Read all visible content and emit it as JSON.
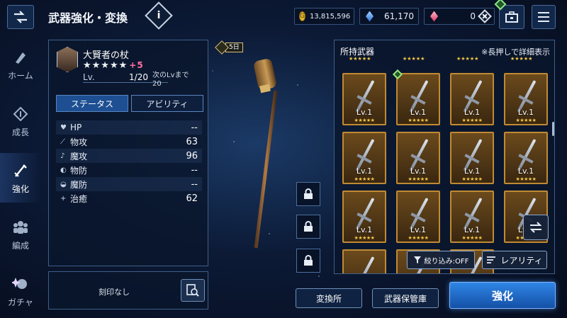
{
  "header": {
    "title": "武器強化・変換",
    "info_label": "i"
  },
  "currency": {
    "gold": "13,815,596",
    "gold_symbol": "G",
    "crystal": "61,170",
    "gem": "0"
  },
  "nav": {
    "items": [
      {
        "label": "ホーム",
        "icon": "home-icon"
      },
      {
        "label": "成長",
        "icon": "growth-icon"
      },
      {
        "label": "強化",
        "icon": "enhance-icon",
        "active": true
      },
      {
        "label": "編成",
        "icon": "party-icon"
      },
      {
        "label": "ガチャ",
        "icon": "gacha-icon"
      }
    ]
  },
  "weapon": {
    "name": "大賢者の杖",
    "stars": "★★★★★",
    "plus": "+5",
    "lv_label": "Lv.",
    "lv_value": "1/20",
    "next_lv_label": "次のLvまで",
    "next_lv_value": "20",
    "limit_badge": "5日"
  },
  "tabs": {
    "status": "ステータス",
    "ability": "アビリティ"
  },
  "stats": [
    {
      "icon": "♥",
      "label": "HP",
      "value": "--"
    },
    {
      "icon": "⟋",
      "label": "物攻",
      "value": "63"
    },
    {
      "icon": "♪",
      "label": "魔攻",
      "value": "96"
    },
    {
      "icon": "◐",
      "label": "物防",
      "value": "--"
    },
    {
      "icon": "◒",
      "label": "魔防",
      "value": "--"
    },
    {
      "icon": "+",
      "label": "治癒",
      "value": "62"
    }
  ],
  "engrave": {
    "label": "刻印なし"
  },
  "owned": {
    "title": "所持武器",
    "hint": "※長押しで詳細表示",
    "slots": [
      {
        "lv": "Lv.1",
        "stars": "★★★★★"
      },
      {
        "lv": "Lv.1",
        "stars": "★★★★★"
      },
      {
        "lv": "Lv.1",
        "stars": "★★★★★"
      },
      {
        "lv": "Lv.1",
        "stars": "★★★★★"
      },
      {
        "lv": "Lv.1",
        "stars": "★★★★★"
      },
      {
        "lv": "Lv.1",
        "stars": "★★★★★"
      },
      {
        "lv": "Lv.1",
        "stars": "★★★★★"
      },
      {
        "lv": "Lv.1",
        "stars": "★★★★★"
      },
      {
        "lv": "Lv.1",
        "stars": "★★★★★"
      },
      {
        "lv": "Lv.1",
        "stars": "★★★★★"
      },
      {
        "lv": "Lv.1",
        "stars": "★★★★★"
      },
      {
        "lv": "Lv.1",
        "stars": "★★★★★"
      }
    ],
    "filter_label": "絞り込み:OFF",
    "rarity_label": "レアリティ"
  },
  "buttons": {
    "exchange": "変換所",
    "storage": "武器保管庫",
    "enhance": "強化"
  }
}
